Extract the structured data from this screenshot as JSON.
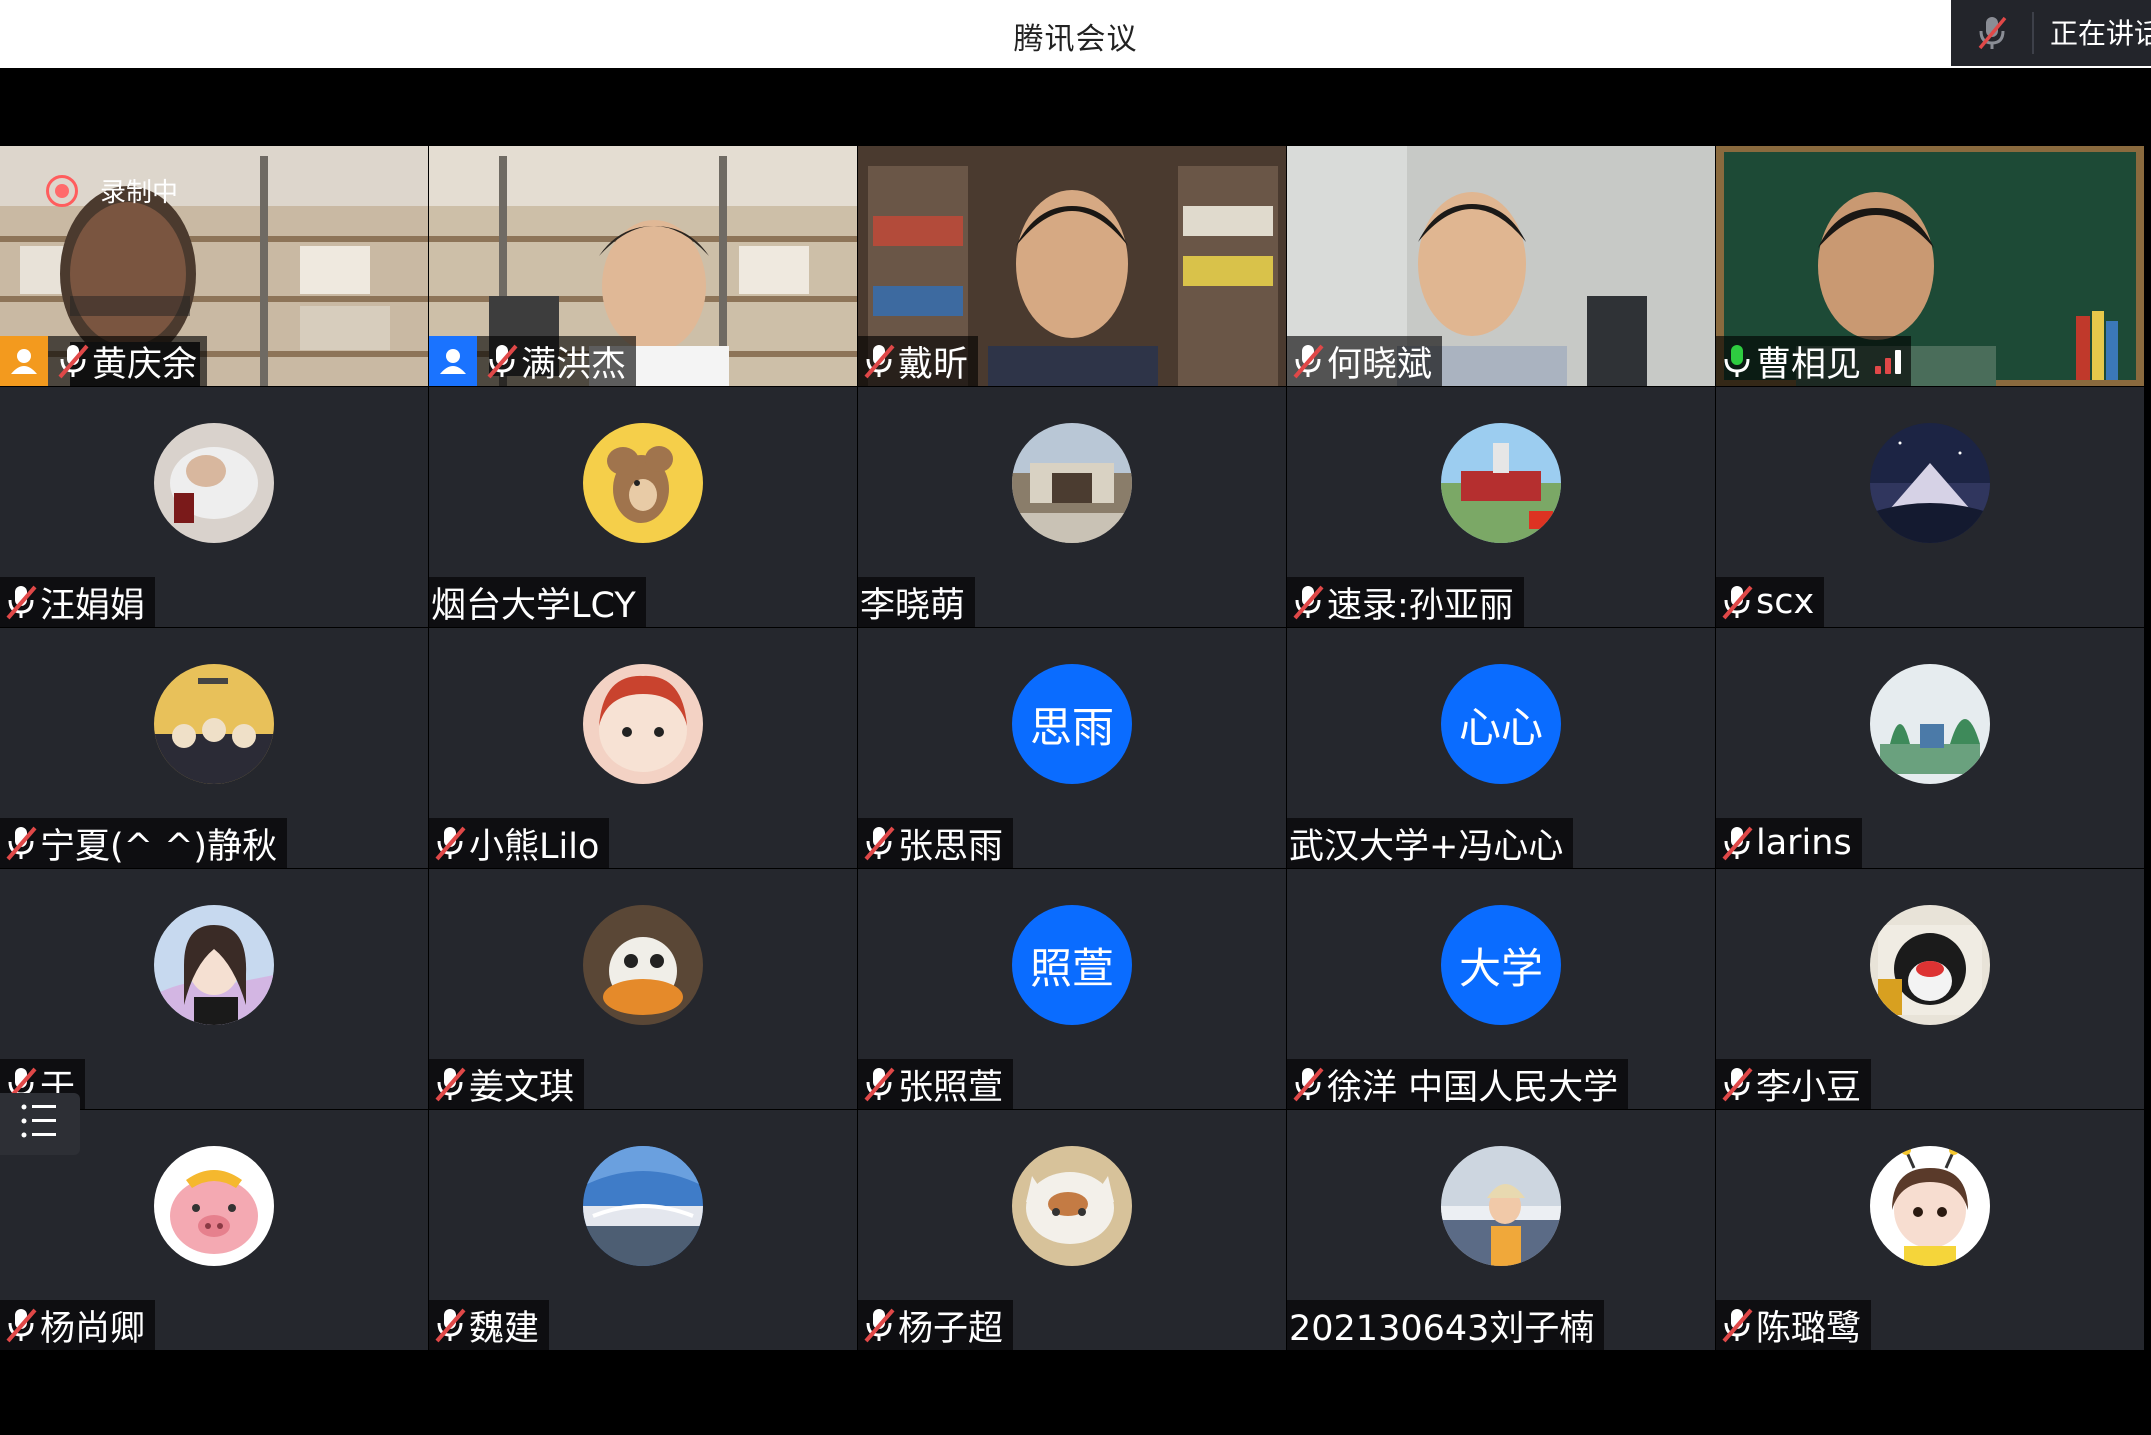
{
  "window": {
    "title": "腾讯会议",
    "speaking_label": "正在讲话"
  },
  "recording": {
    "label": "录制中"
  },
  "participants": [
    {
      "name": "黄庆余"
    },
    {
      "name": "满洪杰"
    },
    {
      "name": "戴昕"
    },
    {
      "name": "何晓斌"
    },
    {
      "name": "曹相见"
    },
    {
      "name": "汪娟娟"
    },
    {
      "name": "烟台大学LCY"
    },
    {
      "name": "李晓萌"
    },
    {
      "name": "速录:孙亚丽"
    },
    {
      "name": "scx"
    },
    {
      "name": "宁夏(^ ^)静秋"
    },
    {
      "name": "小熊Lilo"
    },
    {
      "name": "张思雨",
      "avatar_text": "思雨"
    },
    {
      "name": "武汉大学+冯心心",
      "avatar_text": "心心"
    },
    {
      "name": "larins"
    },
    {
      "name": "于"
    },
    {
      "name": "姜文琪"
    },
    {
      "name": "张照萱",
      "avatar_text": "照萱"
    },
    {
      "name": "徐洋 中国人民大学",
      "avatar_text": "大学"
    },
    {
      "name": "李小豆"
    },
    {
      "name": "杨尚卿"
    },
    {
      "name": "魏建"
    },
    {
      "name": "杨子超"
    },
    {
      "name": "202130643刘子楠"
    },
    {
      "name": "陈璐鹭"
    }
  ],
  "colors": {
    "tile_bg": "#25272d",
    "text_avatar": "#0a6cff",
    "host_orange": "#f39a1e",
    "host_blue": "#1a73ff",
    "mute_red": "#e04848"
  }
}
